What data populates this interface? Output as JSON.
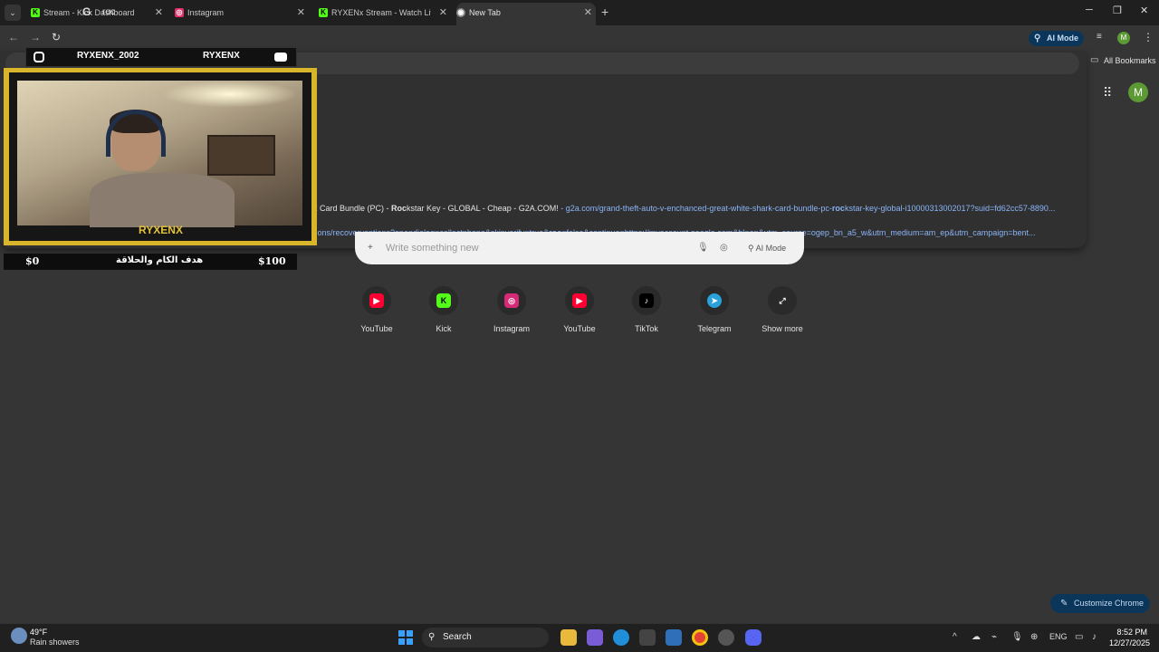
{
  "tabs": [
    {
      "title": "Stream - Kick Dashboard",
      "favicon": "kick-icon",
      "color": "#53fc18"
    },
    {
      "title": "Instagram",
      "favicon": "instagram-icon",
      "color": "#e1306c"
    },
    {
      "title": "RYXENx Stream - Watch Live on Kick",
      "favicon": "kick-icon",
      "color": "#53fc18"
    },
    {
      "title": "New Tab",
      "favicon": "chrome-icon",
      "color": "#aaaaaa"
    }
  ],
  "omnibox": {
    "text": "roc"
  },
  "toolbar": {
    "ai_mode_label": "AI Mode",
    "avatar_letter": "M"
  },
  "bookmarks": {
    "label": "All Bookmarks"
  },
  "suggestions": [
    {
      "pre": "k Card Bundle (PC) - ",
      "bold": "Roc",
      "post": "kstar Key - GLOBAL - Cheap - G2A.COM!",
      "url": " - g2a.com/grand-theft-auto-v-enchanced-great-white-shark-card-bundle-pc-",
      "url_bold": "roc",
      "url_post": "kstar-key-global-i10000313002017?suid=fd62cc57-8890..."
    },
    {
      "pre": "",
      "bold": "",
      "post": "",
      "url": "tions/recoveryoptions?opendialog=collectphone&skipverify=true&",
      "url_bold": "roc",
      "url_post": "=false&continue=https://myaccount.google.com&hl=en&utm_source=ogep_bn_a5_w&utm_medium=am_ep&utm_campaign=bent..."
    }
  ],
  "ntp": {
    "avatar_letter": "M",
    "search_placeholder": "Write something new",
    "search_ai_label": "AI Mode",
    "shortcuts": [
      {
        "label": "YouTube",
        "icon": "youtube-icon",
        "color": "#ff0033"
      },
      {
        "label": "Kick",
        "icon": "kick-icon",
        "color": "#53fc18"
      },
      {
        "label": "Instagram",
        "icon": "instagram-icon",
        "color": "#d62976"
      },
      {
        "label": "YouTube",
        "icon": "youtube-icon",
        "color": "#ff0033"
      },
      {
        "label": "TikTok",
        "icon": "tiktok-icon",
        "color": "#000000"
      },
      {
        "label": "Telegram",
        "icon": "telegram-icon",
        "color": "#2aa1da"
      },
      {
        "label": "Show more",
        "icon": "expand-icon",
        "color": "#555555"
      }
    ],
    "customize_label": "Customize Chrome"
  },
  "overlay": {
    "handle": "RYXENX_2002",
    "channel": "RYXENX",
    "name": "RYXENX",
    "goal_start": "$0",
    "goal_text": "هدف الكام والحلاقة",
    "goal_end": "$100",
    "accent_color": "#d9b52c"
  },
  "taskbar": {
    "weather_temp": "49°F",
    "weather_desc": "Rain showers",
    "search_label": "Search",
    "lang": "ENG",
    "time": "8:52 PM",
    "date": "12/27/2025"
  }
}
